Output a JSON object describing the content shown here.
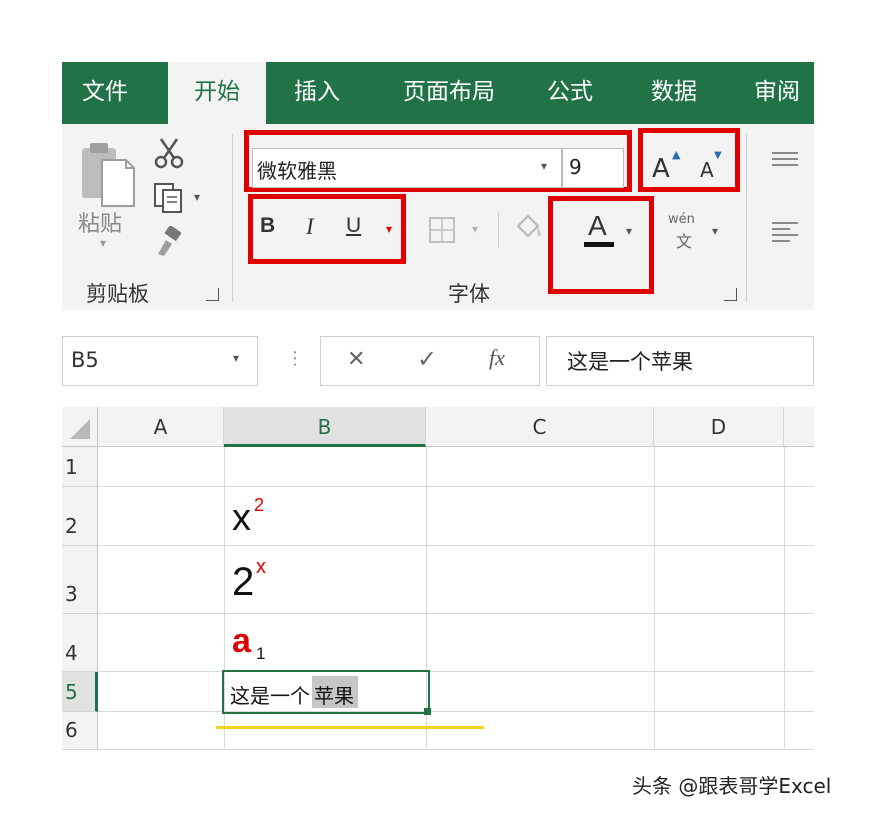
{
  "ribbon": {
    "tabs": [
      "文件",
      "开始",
      "插入",
      "页面布局",
      "公式",
      "数据",
      "审阅"
    ],
    "active_tab": "开始",
    "clipboard": {
      "paste_label": "粘贴",
      "group_label": "剪贴板"
    },
    "font": {
      "font_name": "微软雅黑",
      "font_size": "9",
      "bold": "B",
      "italic": "I",
      "underline": "U",
      "font_color_glyph": "A",
      "wen_top": "wén",
      "wen_bottom": "文",
      "group_label": "字体",
      "grow_glyph": "A",
      "shrink_glyph": "A"
    },
    "highlight_color": "#e00000",
    "accent_color": "#217346"
  },
  "formula_bar": {
    "name_box": "B5",
    "cancel_glyph": "✕",
    "enter_glyph": "✓",
    "fx_glyph": "fx",
    "formula": "这是一个苹果"
  },
  "sheet": {
    "columns": [
      "A",
      "B",
      "C",
      "D"
    ],
    "rows": [
      "1",
      "2",
      "3",
      "4",
      "5",
      "6"
    ],
    "cells": {
      "b2_base": "x",
      "b2_sup": "2",
      "b3_base": "2",
      "b3_sup": "x",
      "b4_base": "a",
      "b4_sub": "1",
      "b5_pre": "这是一个",
      "b5_sel": "苹果"
    },
    "selected_cell": "B5"
  },
  "watermark": "头条 @跟表哥学Excel"
}
